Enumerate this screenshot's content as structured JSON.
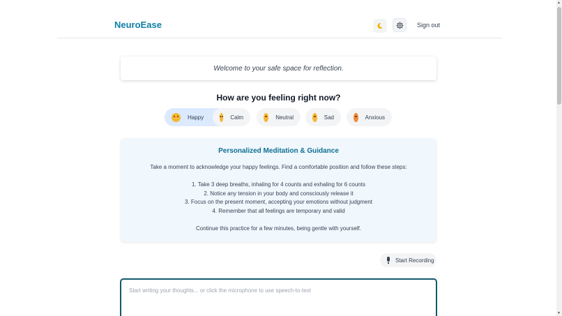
{
  "header": {
    "logo": "NeuroEase",
    "theme_icon": "moon-icon",
    "settings_icon": "gear-icon",
    "signout": "Sign out"
  },
  "welcome": "Welcome to your safe space for reflection.",
  "mood": {
    "title": "How are you feeling right now?",
    "selected": "Happy",
    "options": [
      {
        "label": "Happy",
        "icon": "happy-emoji-icon"
      },
      {
        "label": "Calm",
        "icon": "calm-emoji-icon"
      },
      {
        "label": "Neutral",
        "icon": "neutral-emoji-icon"
      },
      {
        "label": "Sad",
        "icon": "sad-emoji-icon"
      },
      {
        "label": "Anxious",
        "icon": "anxious-emoji-icon"
      }
    ]
  },
  "guidance": {
    "title": "Personalized Meditation & Guidance",
    "intro": "Take a moment to acknowledge your happy feelings. Find a comfortable position and follow these steps:",
    "steps": [
      "1. Take 3 deep breaths, inhaling for 4 counts and exhaling for 6 counts",
      "2. Notice any tension in your body and consciously release it",
      "3. Focus on the present moment, accepting your emotions without judgment",
      "4. Remember that all feelings are temporary and valid"
    ],
    "closing": "Continue this practice for a few minutes, being gentle with yourself."
  },
  "recording": {
    "label": "Start Recording",
    "icon": "microphone-icon"
  },
  "journal": {
    "placeholder": "Start writing your thoughts... or click the microphone to use speech-to-text",
    "value": ""
  },
  "colors": {
    "brand": "#0f7fa6",
    "guidance_bg": "#f0f7fd",
    "selected_mood_bg": "#dbeafe",
    "journal_border": "#12586e"
  }
}
